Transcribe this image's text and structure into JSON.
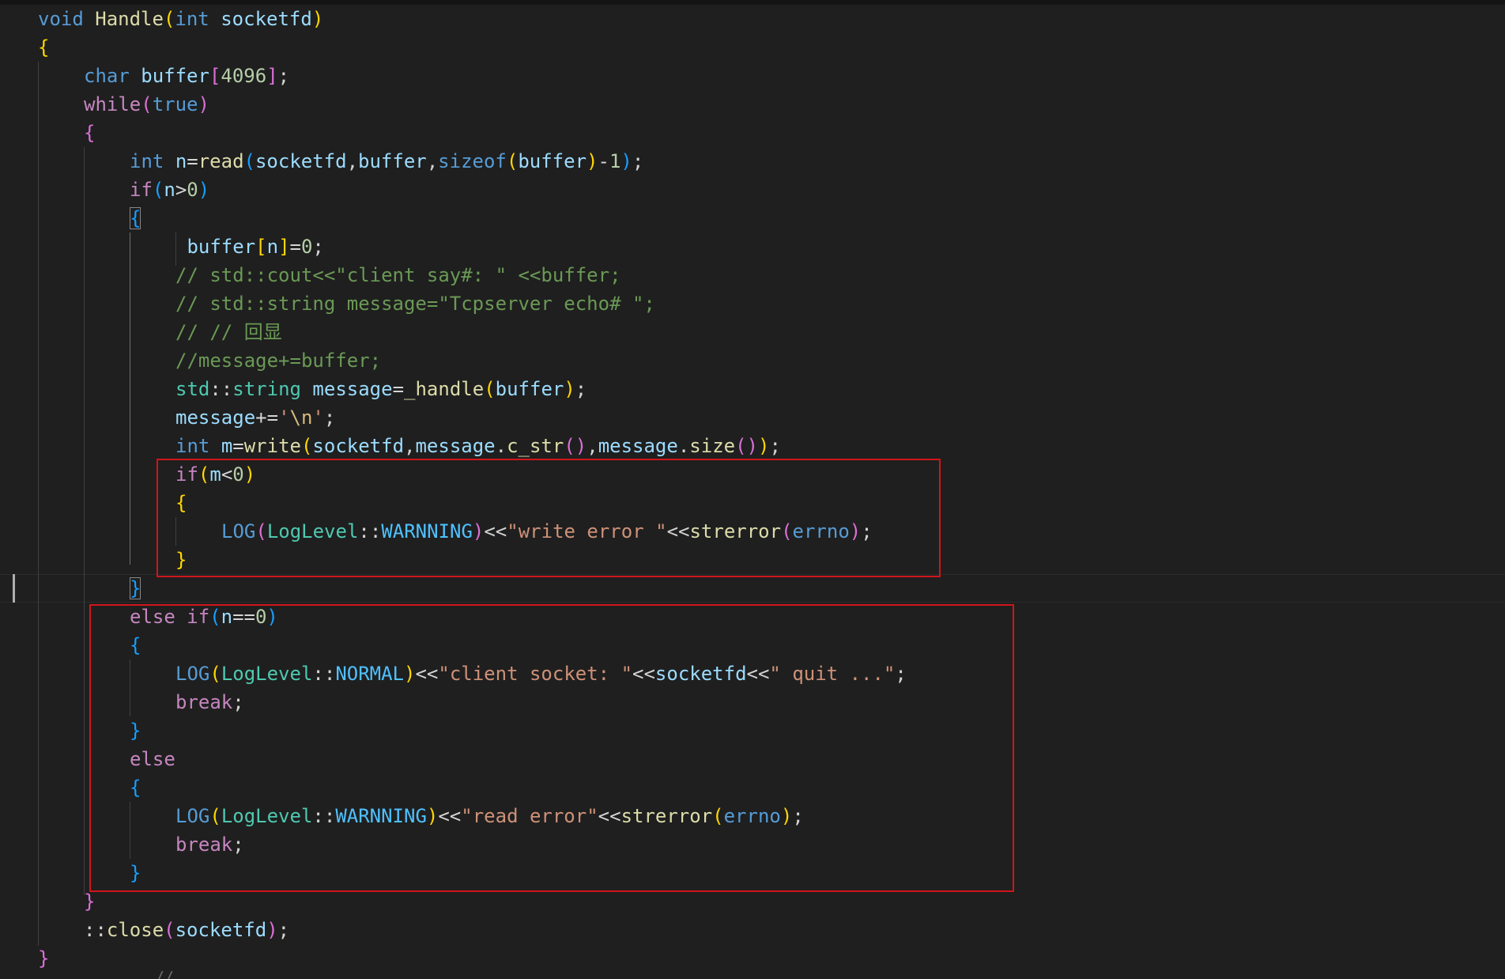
{
  "editor": {
    "theme": {
      "background": "#1f1f1f",
      "highlight_box": "#d0151b",
      "keyword": "#569cd6",
      "control": "#c586c0",
      "function": "#dcdcaa",
      "variable": "#9cdcfe",
      "type": "#4ec9b0",
      "number": "#b5cea8",
      "string": "#ce9178",
      "comment": "#6a9955",
      "enum_member": "#4fc1ff",
      "bracket_1": "#ffd700",
      "bracket_2": "#da70d6",
      "bracket_3": "#179fff"
    },
    "lines": [
      {
        "indent": 0,
        "tokens": [
          {
            "t": "void",
            "c": "kw"
          },
          {
            "t": " ",
            "c": "op"
          },
          {
            "t": "Handle",
            "c": "fn"
          },
          {
            "t": "(",
            "c": "b1"
          },
          {
            "t": "int",
            "c": "kw"
          },
          {
            "t": " ",
            "c": "op"
          },
          {
            "t": "socketfd",
            "c": "var"
          },
          {
            "t": ")",
            "c": "b1"
          }
        ]
      },
      {
        "indent": 0,
        "tokens": [
          {
            "t": "{",
            "c": "b1"
          }
        ]
      },
      {
        "indent": 1,
        "tokens": [
          {
            "t": "char",
            "c": "kw"
          },
          {
            "t": " ",
            "c": "op"
          },
          {
            "t": "buffer",
            "c": "var"
          },
          {
            "t": "[",
            "c": "b2"
          },
          {
            "t": "4096",
            "c": "num"
          },
          {
            "t": "]",
            "c": "b2"
          },
          {
            "t": ";",
            "c": "op"
          }
        ]
      },
      {
        "indent": 1,
        "tokens": [
          {
            "t": "while",
            "c": "ctrl"
          },
          {
            "t": "(",
            "c": "b2"
          },
          {
            "t": "true",
            "c": "kw"
          },
          {
            "t": ")",
            "c": "b2"
          }
        ]
      },
      {
        "indent": 1,
        "tokens": [
          {
            "t": "{",
            "c": "b2"
          }
        ]
      },
      {
        "indent": 2,
        "tokens": [
          {
            "t": "int",
            "c": "kw"
          },
          {
            "t": " ",
            "c": "op"
          },
          {
            "t": "n",
            "c": "var"
          },
          {
            "t": "=",
            "c": "op"
          },
          {
            "t": "read",
            "c": "fn"
          },
          {
            "t": "(",
            "c": "b3"
          },
          {
            "t": "socketfd",
            "c": "var"
          },
          {
            "t": ",",
            "c": "op"
          },
          {
            "t": "buffer",
            "c": "var"
          },
          {
            "t": ",",
            "c": "op"
          },
          {
            "t": "sizeof",
            "c": "kw"
          },
          {
            "t": "(",
            "c": "b1"
          },
          {
            "t": "buffer",
            "c": "var"
          },
          {
            "t": ")",
            "c": "b1"
          },
          {
            "t": "-",
            "c": "op"
          },
          {
            "t": "1",
            "c": "num"
          },
          {
            "t": ")",
            "c": "b3"
          },
          {
            "t": ";",
            "c": "op"
          }
        ]
      },
      {
        "indent": 2,
        "tokens": [
          {
            "t": "if",
            "c": "ctrl"
          },
          {
            "t": "(",
            "c": "b3"
          },
          {
            "t": "n",
            "c": "var"
          },
          {
            "t": ">",
            "c": "op"
          },
          {
            "t": "0",
            "c": "num"
          },
          {
            "t": ")",
            "c": "b3"
          }
        ]
      },
      {
        "indent": 2,
        "tokens": [
          {
            "t": "{",
            "c": "b3",
            "m": true
          }
        ]
      },
      {
        "indent": 3,
        "tokens": [
          {
            "t": " ",
            "c": "op"
          },
          {
            "t": "buffer",
            "c": "var"
          },
          {
            "t": "[",
            "c": "b1"
          },
          {
            "t": "n",
            "c": "var"
          },
          {
            "t": "]",
            "c": "b1"
          },
          {
            "t": "=",
            "c": "op"
          },
          {
            "t": "0",
            "c": "num"
          },
          {
            "t": ";",
            "c": "op"
          }
        ]
      },
      {
        "indent": 3,
        "tokens": [
          {
            "t": "// std::cout<<\"client say#: \" <<buffer;",
            "c": "com"
          }
        ]
      },
      {
        "indent": 3,
        "tokens": [
          {
            "t": "// std::string message=\"Tcpserver echo# \";",
            "c": "com"
          }
        ]
      },
      {
        "indent": 3,
        "tokens": [
          {
            "t": "// // 回显",
            "c": "com"
          }
        ]
      },
      {
        "indent": 3,
        "tokens": [
          {
            "t": "//message+=buffer;",
            "c": "com"
          }
        ]
      },
      {
        "indent": 3,
        "tokens": [
          {
            "t": "std",
            "c": "type"
          },
          {
            "t": "::",
            "c": "op"
          },
          {
            "t": "string",
            "c": "type"
          },
          {
            "t": " ",
            "c": "op"
          },
          {
            "t": "message",
            "c": "var"
          },
          {
            "t": "=",
            "c": "op"
          },
          {
            "t": "_handle",
            "c": "fn"
          },
          {
            "t": "(",
            "c": "b1"
          },
          {
            "t": "buffer",
            "c": "var"
          },
          {
            "t": ")",
            "c": "b1"
          },
          {
            "t": ";",
            "c": "op"
          }
        ]
      },
      {
        "indent": 3,
        "tokens": [
          {
            "t": "message",
            "c": "var"
          },
          {
            "t": "+=",
            "c": "op"
          },
          {
            "t": "'",
            "c": "str"
          },
          {
            "t": "\\n",
            "c": "esc"
          },
          {
            "t": "'",
            "c": "str"
          },
          {
            "t": ";",
            "c": "op"
          }
        ]
      },
      {
        "indent": 3,
        "tokens": [
          {
            "t": "int",
            "c": "kw"
          },
          {
            "t": " ",
            "c": "op"
          },
          {
            "t": "m",
            "c": "var"
          },
          {
            "t": "=",
            "c": "op"
          },
          {
            "t": "write",
            "c": "fn"
          },
          {
            "t": "(",
            "c": "b1"
          },
          {
            "t": "socketfd",
            "c": "var"
          },
          {
            "t": ",",
            "c": "op"
          },
          {
            "t": "message",
            "c": "var"
          },
          {
            "t": ".",
            "c": "op"
          },
          {
            "t": "c_str",
            "c": "fn"
          },
          {
            "t": "()",
            "c": "b2"
          },
          {
            "t": ",",
            "c": "op"
          },
          {
            "t": "message",
            "c": "var"
          },
          {
            "t": ".",
            "c": "op"
          },
          {
            "t": "size",
            "c": "fn"
          },
          {
            "t": "()",
            "c": "b2"
          },
          {
            "t": ")",
            "c": "b1"
          },
          {
            "t": ";",
            "c": "op"
          }
        ]
      },
      {
        "indent": 3,
        "tokens": [
          {
            "t": "if",
            "c": "ctrl"
          },
          {
            "t": "(",
            "c": "b1"
          },
          {
            "t": "m",
            "c": "var"
          },
          {
            "t": "<",
            "c": "op"
          },
          {
            "t": "0",
            "c": "num"
          },
          {
            "t": ")",
            "c": "b1"
          }
        ]
      },
      {
        "indent": 3,
        "tokens": [
          {
            "t": "{",
            "c": "b1"
          }
        ]
      },
      {
        "indent": 4,
        "tokens": [
          {
            "t": "LOG",
            "c": "kw"
          },
          {
            "t": "(",
            "c": "b2"
          },
          {
            "t": "LogLevel",
            "c": "type"
          },
          {
            "t": "::",
            "c": "op"
          },
          {
            "t": "WARNNING",
            "c": "enum"
          },
          {
            "t": ")",
            "c": "b2"
          },
          {
            "t": "<<",
            "c": "op"
          },
          {
            "t": "\"write error \"",
            "c": "str"
          },
          {
            "t": "<<",
            "c": "op"
          },
          {
            "t": "strerror",
            "c": "fn"
          },
          {
            "t": "(",
            "c": "b2"
          },
          {
            "t": "errno",
            "c": "kw"
          },
          {
            "t": ")",
            "c": "b2"
          },
          {
            "t": ";",
            "c": "op"
          }
        ]
      },
      {
        "indent": 3,
        "tokens": [
          {
            "t": "}",
            "c": "b1"
          }
        ]
      },
      {
        "indent": 2,
        "tokens": [
          {
            "t": "}",
            "c": "b3",
            "m": true
          }
        ]
      },
      {
        "indent": 2,
        "tokens": [
          {
            "t": "else",
            "c": "ctrl"
          },
          {
            "t": " ",
            "c": "op"
          },
          {
            "t": "if",
            "c": "ctrl"
          },
          {
            "t": "(",
            "c": "b3"
          },
          {
            "t": "n",
            "c": "var"
          },
          {
            "t": "==",
            "c": "op"
          },
          {
            "t": "0",
            "c": "num"
          },
          {
            "t": ")",
            "c": "b3"
          }
        ]
      },
      {
        "indent": 2,
        "tokens": [
          {
            "t": "{",
            "c": "b3"
          }
        ]
      },
      {
        "indent": 3,
        "tokens": [
          {
            "t": "LOG",
            "c": "kw"
          },
          {
            "t": "(",
            "c": "b1"
          },
          {
            "t": "LogLevel",
            "c": "type"
          },
          {
            "t": "::",
            "c": "op"
          },
          {
            "t": "NORMAL",
            "c": "enum"
          },
          {
            "t": ")",
            "c": "b1"
          },
          {
            "t": "<<",
            "c": "op"
          },
          {
            "t": "\"client socket: \"",
            "c": "str"
          },
          {
            "t": "<<",
            "c": "op"
          },
          {
            "t": "socketfd",
            "c": "var"
          },
          {
            "t": "<<",
            "c": "op"
          },
          {
            "t": "\" quit ...\"",
            "c": "str"
          },
          {
            "t": ";",
            "c": "op"
          }
        ]
      },
      {
        "indent": 3,
        "tokens": [
          {
            "t": "break",
            "c": "ctrl"
          },
          {
            "t": ";",
            "c": "op"
          }
        ]
      },
      {
        "indent": 2,
        "tokens": [
          {
            "t": "}",
            "c": "b3"
          }
        ]
      },
      {
        "indent": 2,
        "tokens": [
          {
            "t": "else",
            "c": "ctrl"
          }
        ]
      },
      {
        "indent": 2,
        "tokens": [
          {
            "t": "{",
            "c": "b3"
          }
        ]
      },
      {
        "indent": 3,
        "tokens": [
          {
            "t": "LOG",
            "c": "kw"
          },
          {
            "t": "(",
            "c": "b1"
          },
          {
            "t": "LogLevel",
            "c": "type"
          },
          {
            "t": "::",
            "c": "op"
          },
          {
            "t": "WARNNING",
            "c": "enum"
          },
          {
            "t": ")",
            "c": "b1"
          },
          {
            "t": "<<",
            "c": "op"
          },
          {
            "t": "\"read error\"",
            "c": "str"
          },
          {
            "t": "<<",
            "c": "op"
          },
          {
            "t": "strerror",
            "c": "fn"
          },
          {
            "t": "(",
            "c": "b1"
          },
          {
            "t": "errno",
            "c": "kw"
          },
          {
            "t": ")",
            "c": "b1"
          },
          {
            "t": ";",
            "c": "op"
          }
        ]
      },
      {
        "indent": 3,
        "tokens": [
          {
            "t": "break",
            "c": "ctrl"
          },
          {
            "t": ";",
            "c": "op"
          }
        ]
      },
      {
        "indent": 2,
        "tokens": [
          {
            "t": "}",
            "c": "b3"
          }
        ]
      },
      {
        "indent": 1,
        "tokens": [
          {
            "t": "}",
            "c": "b2"
          }
        ]
      },
      {
        "indent": 1,
        "tokens": [
          {
            "t": "::",
            "c": "op"
          },
          {
            "t": "close",
            "c": "fn"
          },
          {
            "t": "(",
            "c": "b2"
          },
          {
            "t": "socketfd",
            "c": "var"
          },
          {
            "t": ")",
            "c": "b2"
          },
          {
            "t": ";",
            "c": "op"
          }
        ]
      },
      {
        "indent": 0,
        "tokens": [
          {
            "t": "}",
            "c": "b2"
          }
        ]
      }
    ],
    "bottom_partial_text": "//"
  }
}
